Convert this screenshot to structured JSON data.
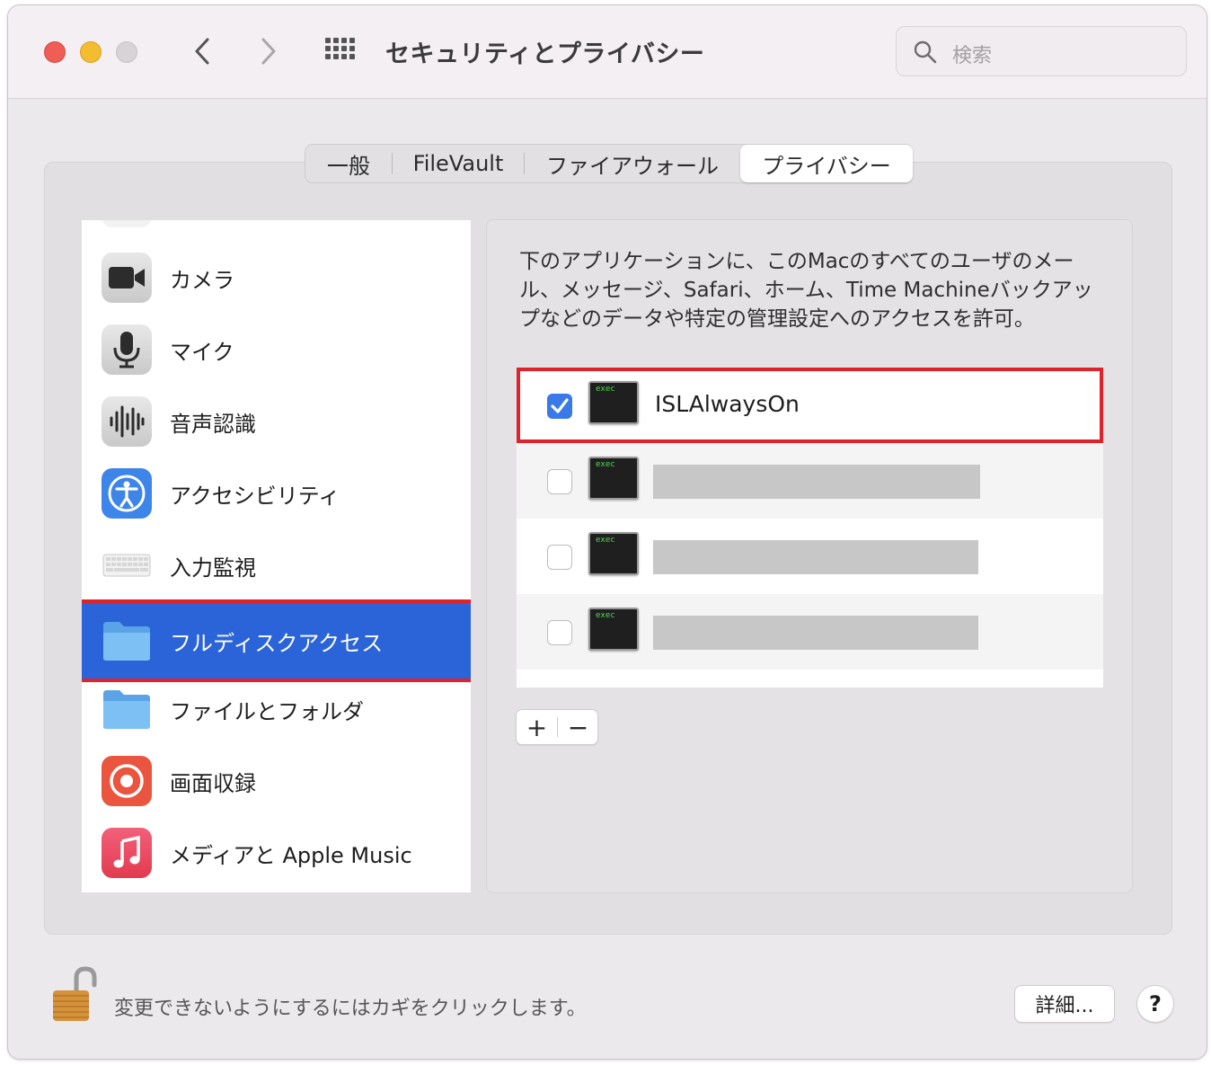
{
  "window": {
    "title": "セキュリティとプライバシー"
  },
  "search": {
    "placeholder": "検索"
  },
  "tabs": [
    {
      "label": "一般",
      "selected": false
    },
    {
      "label": "FileVault",
      "selected": false
    },
    {
      "label": "ファイアウォール",
      "selected": false
    },
    {
      "label": "プライバシー",
      "selected": true
    }
  ],
  "sidebar": {
    "items": [
      {
        "label": "カメラ",
        "icon": "camera-icon"
      },
      {
        "label": "マイク",
        "icon": "microphone-icon"
      },
      {
        "label": "音声認識",
        "icon": "speech-recognition-icon"
      },
      {
        "label": "アクセシビリティ",
        "icon": "accessibility-icon"
      },
      {
        "label": "入力監視",
        "icon": "keyboard-icon"
      },
      {
        "label": "フルディスクアクセス",
        "icon": "folder-icon",
        "selected": true
      },
      {
        "label": "ファイルとフォルダ",
        "icon": "folder-icon"
      },
      {
        "label": "画面収録",
        "icon": "screen-recording-icon"
      },
      {
        "label": "メディアと Apple Music",
        "icon": "music-icon"
      }
    ]
  },
  "detail": {
    "description": "下のアプリケーションに、このMacのすべてのユーザのメール、メッセージ、Safari、ホーム、Time Machineバックアップなどのデータや特定の管理設定へのアクセスを許可。",
    "apps": [
      {
        "name": "ISLAlwaysOn",
        "checked": true,
        "icon_text": "exec"
      },
      {
        "name": "",
        "checked": false,
        "icon_text": "exec"
      },
      {
        "name": "",
        "checked": false,
        "icon_text": "exec"
      },
      {
        "name": "",
        "checked": false,
        "icon_text": "exec"
      }
    ],
    "add_label": "+",
    "remove_label": "−"
  },
  "footer": {
    "lock_text": "変更できないようにするにはカギをクリックします。",
    "details_label": "詳細...",
    "help_label": "?"
  },
  "colors": {
    "selection": "#2b64d8",
    "highlight_border": "#e0222a",
    "checkbox_checked": "#3a7ae8"
  }
}
